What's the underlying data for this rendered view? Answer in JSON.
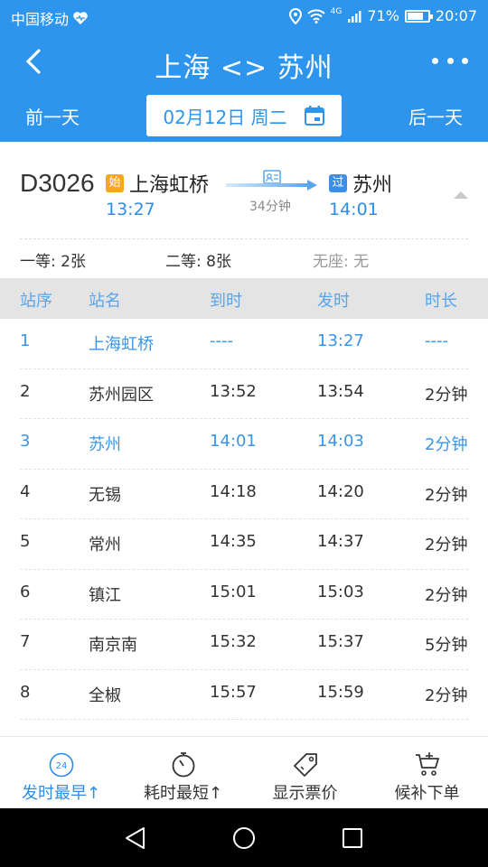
{
  "status_bar": {
    "carrier": "中国移动",
    "signal_label": "4G",
    "battery": "71%",
    "battery_level": 0.71,
    "time": "20:07"
  },
  "header": {
    "title": "上海 <> 苏州"
  },
  "date_nav": {
    "prev_label": "前一天",
    "date_label": "02月12日 周二",
    "next_label": "后一天"
  },
  "train": {
    "number": "D3026",
    "from_badge": "始",
    "from_station": "上海虹桥",
    "from_time": "13:27",
    "duration": "34分钟",
    "to_badge": "过",
    "to_station": "苏州",
    "to_time": "14:01"
  },
  "seats": [
    {
      "label": "一等: 2张"
    },
    {
      "label": "二等: 8张"
    },
    {
      "label": "无座: 无"
    }
  ],
  "table": {
    "headers": [
      "站序",
      "站名",
      "到时",
      "发时",
      "时长"
    ],
    "rows": [
      {
        "no": "1",
        "station": "上海虹桥",
        "arrive": "----",
        "depart": "13:27",
        "stay": "----",
        "highlight": true
      },
      {
        "no": "2",
        "station": "苏州园区",
        "arrive": "13:52",
        "depart": "13:54",
        "stay": "2分钟",
        "highlight": false
      },
      {
        "no": "3",
        "station": "苏州",
        "arrive": "14:01",
        "depart": "14:03",
        "stay": "2分钟",
        "highlight": true
      },
      {
        "no": "4",
        "station": "无锡",
        "arrive": "14:18",
        "depart": "14:20",
        "stay": "2分钟",
        "highlight": false
      },
      {
        "no": "5",
        "station": "常州",
        "arrive": "14:35",
        "depart": "14:37",
        "stay": "2分钟",
        "highlight": false
      },
      {
        "no": "6",
        "station": "镇江",
        "arrive": "15:01",
        "depart": "15:03",
        "stay": "2分钟",
        "highlight": false
      },
      {
        "no": "7",
        "station": "南京南",
        "arrive": "15:32",
        "depart": "15:37",
        "stay": "5分钟",
        "highlight": false
      },
      {
        "no": "8",
        "station": "全椒",
        "arrive": "15:57",
        "depart": "15:59",
        "stay": "2分钟",
        "highlight": false
      }
    ]
  },
  "tab_bar": {
    "tabs": [
      {
        "label": "发时最早↑",
        "icon": "clock-24-icon",
        "icon_text": "24",
        "active": true
      },
      {
        "label": "耗时最短↑",
        "icon": "stopwatch-icon",
        "active": false
      },
      {
        "label": "显示票价",
        "icon": "price-tag-icon",
        "active": false
      },
      {
        "label": "候补下单",
        "icon": "cart-add-icon",
        "active": false
      }
    ]
  },
  "colors": {
    "primary": "#2d95ee",
    "highlight_text": "#3a95e8",
    "badge_start": "#f5a623",
    "badge_pass": "#3c8fe6"
  }
}
